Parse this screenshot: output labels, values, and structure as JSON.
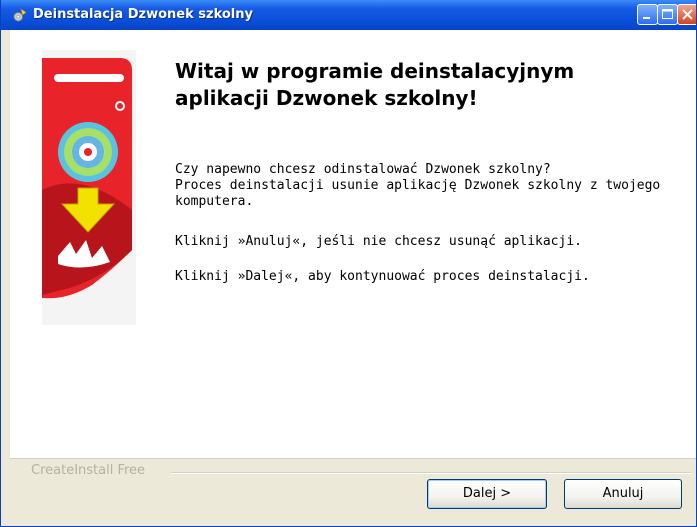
{
  "window": {
    "title": "Deinstalacja Dzwonek szkolny",
    "controls": [
      "minimize",
      "maximize",
      "close"
    ]
  },
  "main": {
    "heading": [
      "Witaj w programie deinstalacyjnym",
      "aplikacji Dzwonek szkolny!"
    ],
    "paragraph1": [
      "Czy napewno chcesz odinstalować Dzwonek szkolny?",
      "Proces deinstalacji usunie aplikację Dzwonek szkolny z twojego",
      "komputera."
    ],
    "paragraph2": "Kliknij »Anuluj«, jeśli nie chcesz usunąć aplikacji.",
    "paragraph3": "Kliknij »Dalej«, aby kontynuować proces deinstalacji."
  },
  "footer": {
    "brand": "CreateInstall Free",
    "next_label": "Dalej >",
    "cancel_label": "Anuluj"
  },
  "colors": {
    "titlebar": "#0a4fd8",
    "banner_red": "#e8232a",
    "arrow_yellow": "#f3e100",
    "footer_bg": "#ece9d8"
  }
}
